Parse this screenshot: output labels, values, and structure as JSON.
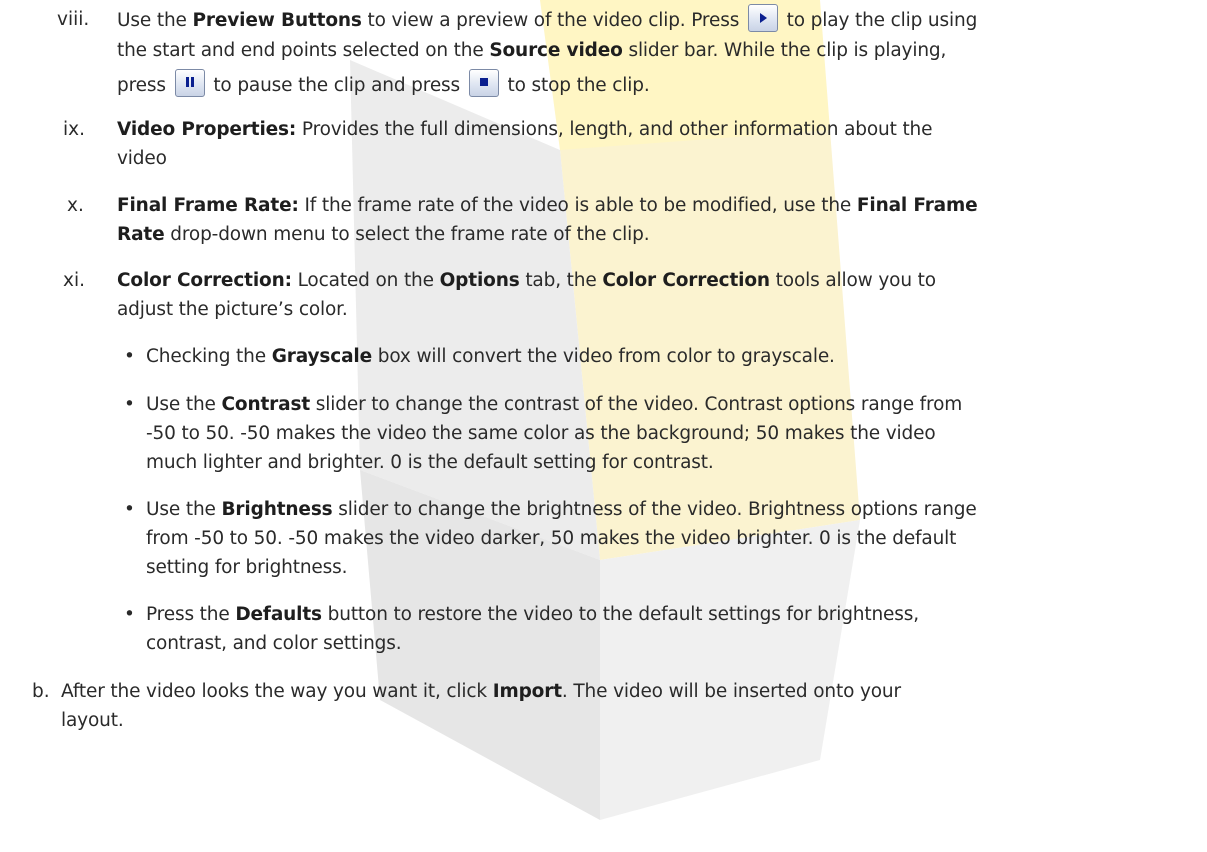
{
  "colors": {
    "text": "#2a2a2a",
    "watermark_yellow": "#ffef9f",
    "watermark_gray": "#d8d8d8",
    "icon_blue": "#0a1f8f"
  },
  "items": {
    "viii": {
      "marker": "viii.",
      "p1": "Use the ",
      "b1": "Preview Buttons",
      "p2": " to view a preview of the video clip. Press ",
      "p3": " to play the clip using",
      "p4": "the start and end points selected on the ",
      "b2": "Source video",
      "p5": " slider bar. While the clip is playing,",
      "p6": "press ",
      "p7": " to pause the clip and press ",
      "p8": " to stop the clip.",
      "icons": [
        "play-icon",
        "pause-icon",
        "stop-icon"
      ]
    },
    "ix": {
      "marker": "ix.",
      "b1": "Video Properties:",
      "p1": " Provides the full dimensions, length, and other information about the",
      "p2": "video"
    },
    "x": {
      "marker": "x.",
      "b1": "Final Frame Rate:",
      "p1": " If the frame rate of the video is able to be modified, use the ",
      "b2": "Final Frame",
      "b3": "Rate",
      "p2": " drop-down menu to select the frame rate of the clip."
    },
    "xi": {
      "marker": "xi.",
      "b1": "Color Correction:",
      "p1": " Located on the ",
      "b2": "Options",
      "p2": " tab, the ",
      "b3": "Color Correction",
      "p3": " tools allow you to",
      "p4": "adjust the picture’s color."
    },
    "bullets": {
      "b1": {
        "p1": "Checking the ",
        "b": "Grayscale",
        "p2": " box will convert the video from color to grayscale."
      },
      "b2": {
        "p1": "Use the ",
        "b": "Contrast",
        "p2": " slider to change the contrast of the video. Contrast options range from",
        "l2": "-50 to 50. -50 makes the video the same color as the background; 50 makes the video",
        "l3": "much lighter and brighter. 0 is the default setting for contrast."
      },
      "b3": {
        "p1": "Use the ",
        "b": "Brightness",
        "p2": " slider to change the brightness of the video. Brightness options range",
        "l2": "from -50 to 50. -50 makes the video darker, 50 makes the video brighter. 0 is the default",
        "l3": "setting for brightness."
      },
      "b4": {
        "p1": "Press the ",
        "b": "Defaults",
        "p2": " button to restore the video to the default settings for brightness,",
        "l2": "contrast, and color settings."
      }
    },
    "b": {
      "marker": "b.",
      "p1": "After the video looks the way you want it, click ",
      "b1": "Import",
      "p2": ". The video will be inserted onto your",
      "l2": "layout."
    }
  }
}
